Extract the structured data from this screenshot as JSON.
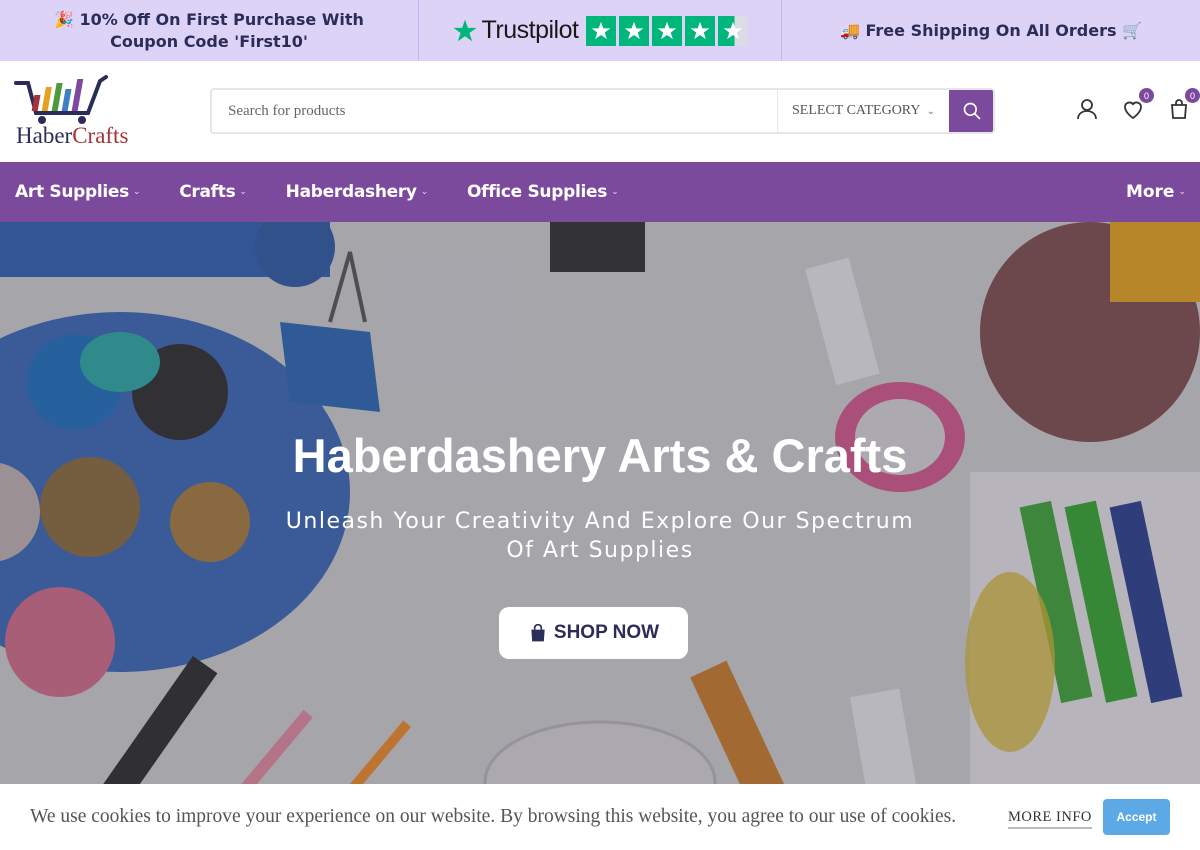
{
  "promo": {
    "coupon_text": "🎉 10% Off On First Purchase With Coupon Code 'First10'",
    "trustpilot_brand": "Trustpilot",
    "trustpilot_rating": 4.5,
    "shipping_text": "🚚 Free Shipping On All Orders 🛒"
  },
  "logo": {
    "name_part1": "Haber",
    "name_part2": "Crafts"
  },
  "search": {
    "placeholder": "Search for products",
    "category_label": "SELECT CATEGORY"
  },
  "header_icons": {
    "wishlist_count": "0",
    "cart_count": "0"
  },
  "nav": {
    "items": [
      {
        "label": "Art Supplies"
      },
      {
        "label": "Crafts"
      },
      {
        "label": "Haberdashery"
      },
      {
        "label": "Office Supplies"
      }
    ],
    "more_label": "More"
  },
  "hero": {
    "title": "Haberdashery Arts & Crafts",
    "subtitle": "Unleash Your Creativity And Explore Our Spectrum Of Art Supplies",
    "button_label": "SHOP NOW"
  },
  "cookie": {
    "message": "We use cookies to improve your experience on our website. By browsing this website, you agree to our use of cookies.",
    "more_info_label": "MORE INFO",
    "accept_label": "Accept"
  },
  "colors": {
    "promo_bg": "#ddd3f7",
    "brand_purple": "#7c4a9d",
    "navy": "#2b2c58",
    "trustpilot_green": "#00b67a",
    "accept_blue": "#5da9e6"
  }
}
